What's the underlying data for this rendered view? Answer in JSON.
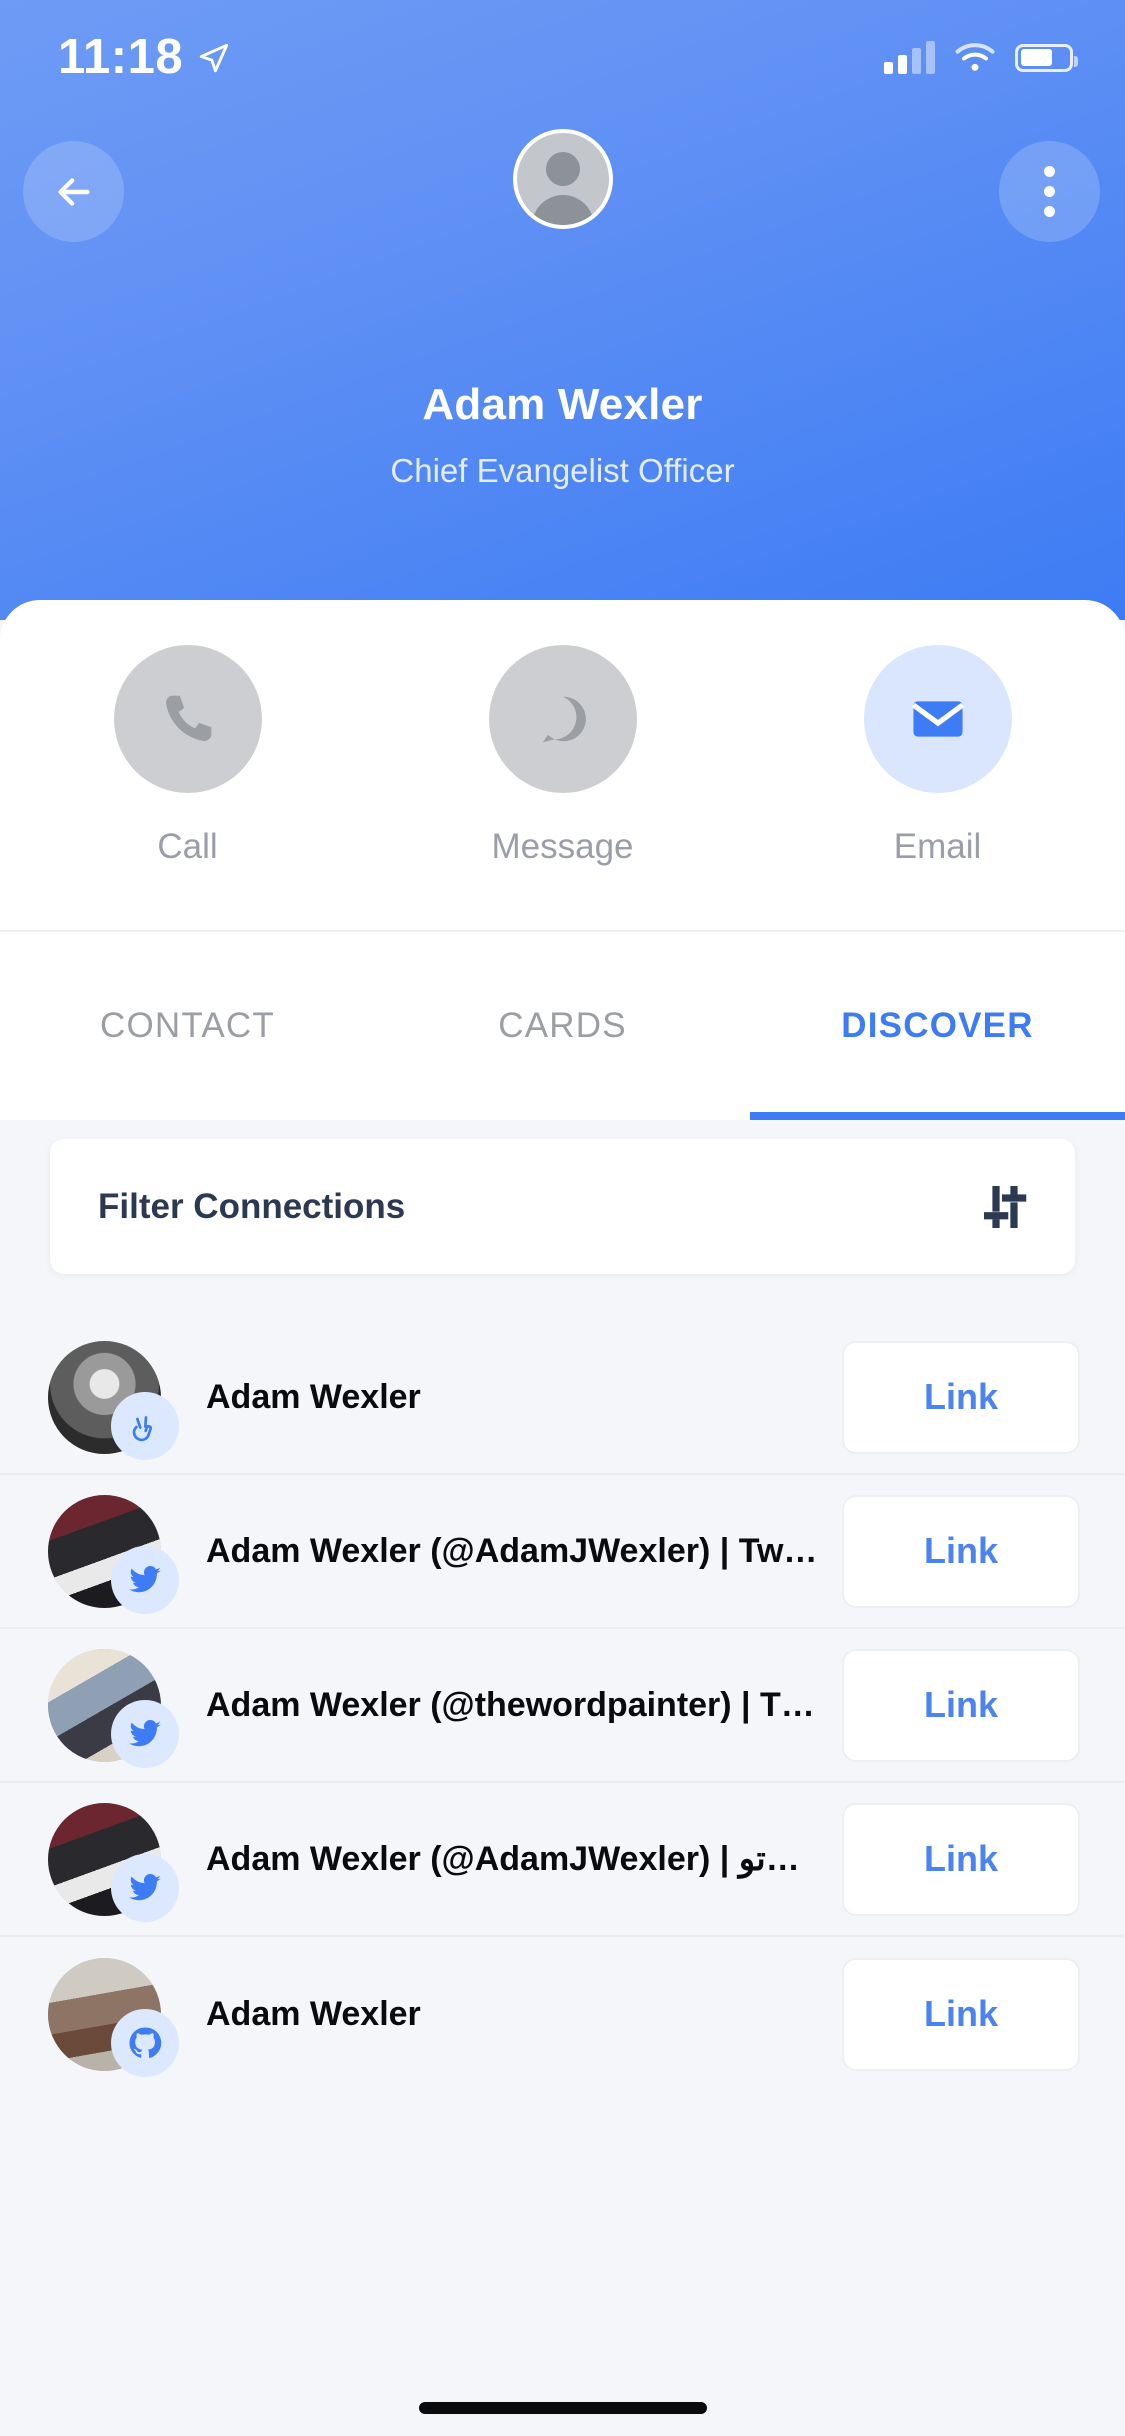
{
  "statusbar": {
    "time": "11:18",
    "location_icon": "location-arrow-icon",
    "cellular_icon": "cellular-bars-icon",
    "wifi_icon": "wifi-icon",
    "battery_icon": "battery-icon"
  },
  "header": {
    "back_icon": "back-arrow-icon",
    "more_icon": "more-vertical-icon",
    "avatar_icon": "person-placeholder-avatar",
    "name": "Adam Wexler",
    "title": "Chief Evangelist Officer",
    "accent_color": "#3d7cf4",
    "background_color": "#5f90f4"
  },
  "actions": [
    {
      "label": "Call",
      "icon": "phone-icon",
      "state": "disabled",
      "circle_color": "#cdced1",
      "icon_color": "#9b9ea3"
    },
    {
      "label": "Message",
      "icon": "chat-bubble-icon",
      "state": "disabled",
      "circle_color": "#cdced1",
      "icon_color": "#9b9ea3"
    },
    {
      "label": "Email",
      "icon": "envelope-icon",
      "state": "enabled",
      "circle_color": "#d9e6fe",
      "icon_color": "#3d7cf4"
    }
  ],
  "tabs": [
    {
      "label": "CONTACT",
      "active": false
    },
    {
      "label": "CARDS",
      "active": false
    },
    {
      "label": "DISCOVER",
      "active": true
    }
  ],
  "filter": {
    "label": "Filter Connections",
    "icon": "filter-sliders-icon",
    "icon_color": "#2b3a52"
  },
  "connections": {
    "link_label": "Link",
    "items": [
      {
        "name": "Adam Wexler",
        "source": "angellist",
        "badge_icon": "angellist-peace-hand-icon",
        "photo": "ph1"
      },
      {
        "name": "Adam Wexler (@AdamJWexler) | Tw…",
        "source": "twitter",
        "badge_icon": "twitter-bird-icon",
        "photo": "ph2"
      },
      {
        "name": "Adam Wexler (@thewordpainter) | T…",
        "source": "twitter",
        "badge_icon": "twitter-bird-icon",
        "photo": "ph3"
      },
      {
        "name": "Adam Wexler (@AdamJWexler) | تو…",
        "source": "twitter",
        "badge_icon": "twitter-bird-icon",
        "photo": "ph4"
      },
      {
        "name": "Adam Wexler",
        "source": "github",
        "badge_icon": "github-cat-icon",
        "photo": "ph5"
      }
    ]
  },
  "home_indicator": "home-indicator"
}
